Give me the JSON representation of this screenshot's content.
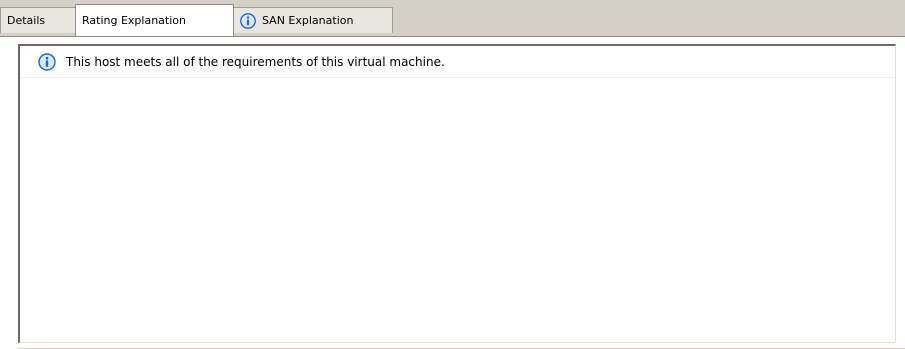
{
  "tabs": [
    {
      "label": "Details",
      "icon": null,
      "selected": false
    },
    {
      "label": "Rating Explanation",
      "icon": null,
      "selected": true
    },
    {
      "label": "SAN Explanation",
      "icon": "info-icon",
      "selected": false
    }
  ],
  "panel": {
    "messages": [
      {
        "icon": "info-icon",
        "text": "This host meets all of the requirements of this virtual machine."
      }
    ]
  },
  "colors": {
    "chrome": "#d4d0c8",
    "panel_background": "#ffffff",
    "info_icon_fill": "#1f66d6"
  }
}
